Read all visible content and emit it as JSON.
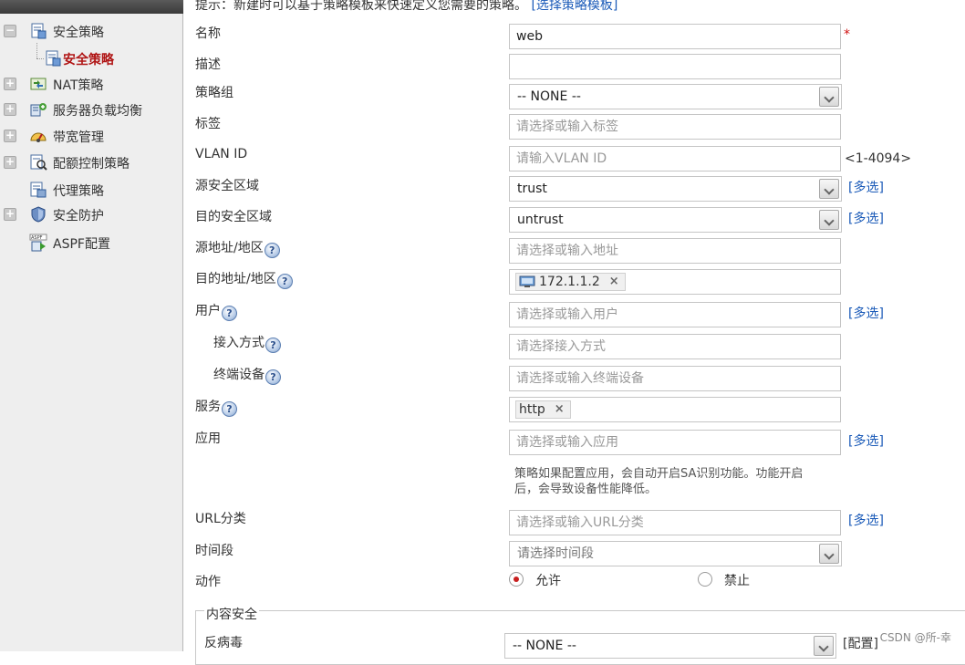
{
  "sidebar": {
    "items": [
      {
        "label": "安全策略",
        "icon": "policy-doc-icon",
        "toggle": "−",
        "level": 0
      },
      {
        "label": "安全策略",
        "icon": "policy-doc-icon",
        "toggle": "",
        "level": 1
      },
      {
        "label": "NAT策略",
        "icon": "nat-icon",
        "toggle": "+",
        "level": 0
      },
      {
        "label": "服务器负载均衡",
        "icon": "server-lb-icon",
        "toggle": "+",
        "level": 0
      },
      {
        "label": "带宽管理",
        "icon": "bandwidth-icon",
        "toggle": "+",
        "level": 0
      },
      {
        "label": "配额控制策略",
        "icon": "quota-icon",
        "toggle": "+",
        "level": 0
      },
      {
        "label": "代理策略",
        "icon": "proxy-icon",
        "toggle": "",
        "level": 0
      },
      {
        "label": "安全防护",
        "icon": "shield-icon",
        "toggle": "+",
        "level": 0
      },
      {
        "label": "ASPF配置",
        "icon": "aspf-icon",
        "toggle": "",
        "level": 0
      }
    ]
  },
  "form": {
    "hint_text": "提示：新建时可以基于策略模板来快速定义您需要的策略。",
    "hint_link": "[选择策略模板]",
    "name_label": "名称",
    "name_value": "web",
    "required_mark": "*",
    "desc_label": "描述",
    "desc_value": "",
    "group_label": "策略组",
    "group_value": "-- NONE --",
    "tag_label": "标签",
    "tag_placeholder": "请选择或输入标签",
    "vlan_label": "VLAN ID",
    "vlan_placeholder": "请输入VLAN ID",
    "vlan_range": "<1-4094>",
    "src_zone_label": "源安全区域",
    "src_zone_value": "trust",
    "dst_zone_label": "目的安全区域",
    "dst_zone_value": "untrust",
    "src_addr_label": "源地址/地区",
    "src_addr_placeholder": "请选择或输入地址",
    "dst_addr_label": "目的地址/地区",
    "dst_addr_tag": "172.1.1.2",
    "user_label": "用户",
    "user_placeholder": "请选择或输入用户",
    "access_label": "接入方式",
    "access_placeholder": "请选择接入方式",
    "device_label": "终端设备",
    "device_placeholder": "请选择或输入终端设备",
    "service_label": "服务",
    "service_tag": "http",
    "app_label": "应用",
    "app_placeholder": "请选择或输入应用",
    "app_note_line1": "策略如果配置应用，会自动开启SA识别功能。功能开启",
    "app_note_line2": "后，会导致设备性能降低。",
    "url_label": "URL分类",
    "url_placeholder": "请选择或输入URL分类",
    "time_label": "时间段",
    "time_placeholder": "请选择时间段",
    "action_label": "动作",
    "action_permit": "允许",
    "action_deny": "禁止",
    "multi_select": "[多选]",
    "content_security_legend": "内容安全",
    "antivirus_label": "反病毒",
    "antivirus_value": "-- NONE --",
    "configure_link": "[配置]",
    "tag_remove": "×",
    "help_mark": "?"
  },
  "watermark": "CSDN @所-幸"
}
